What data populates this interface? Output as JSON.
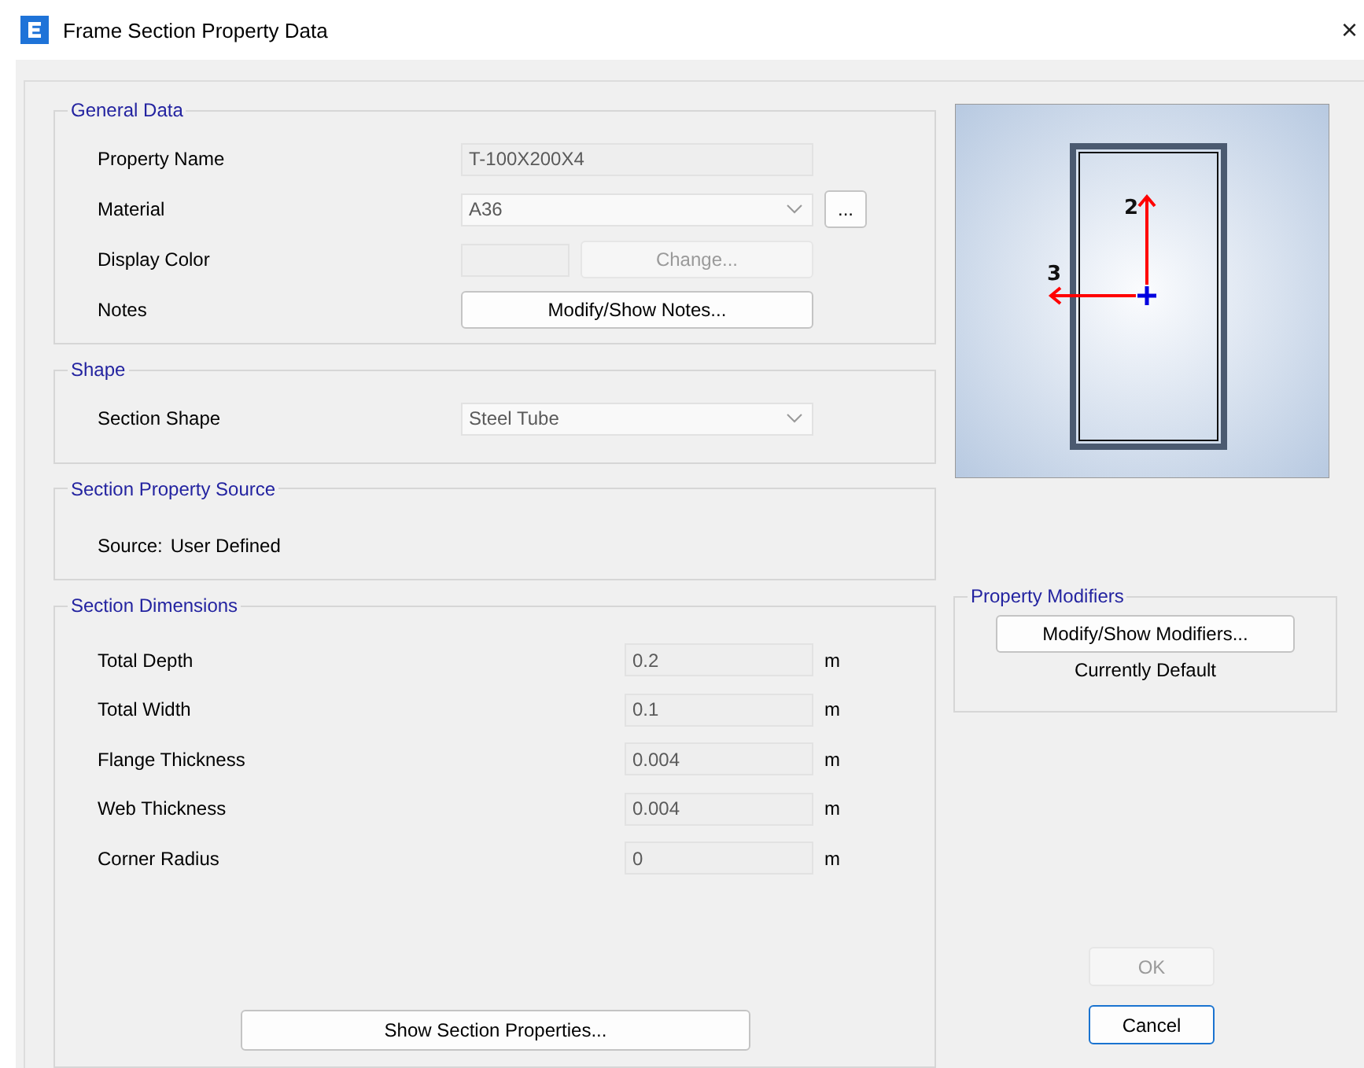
{
  "window": {
    "title": "Frame Section Property Data",
    "close": "×"
  },
  "general_data": {
    "title": "General Data",
    "rows": [
      {
        "kind": "text",
        "label": "Property Name",
        "value": "T-100X200X4",
        "disabled": true
      },
      {
        "kind": "dropdown",
        "label": "Material",
        "value": "A36",
        "disabled": true,
        "extra_button": "..."
      },
      {
        "kind": "color",
        "label": "Display Color",
        "button": "Change...",
        "disabled": true
      },
      {
        "kind": "button",
        "label": "Notes",
        "button": "Modify/Show Notes...",
        "disabled": false
      }
    ]
  },
  "shape": {
    "title": "Shape",
    "rows": [
      {
        "kind": "dropdown",
        "label": "Section Shape",
        "value": "Steel Tube",
        "disabled": true
      }
    ]
  },
  "source": {
    "title": "Section Property Source",
    "label": "Source:",
    "value": "User Defined"
  },
  "dimensions": {
    "title": "Section Dimensions",
    "rows": [
      {
        "label": "Total Depth",
        "value": "0.2",
        "unit": "m"
      },
      {
        "label": "Total Width",
        "value": "0.1",
        "unit": "m"
      },
      {
        "label": "Flange Thickness",
        "value": "0.004",
        "unit": "m"
      },
      {
        "label": "Web Thickness",
        "value": "0.004",
        "unit": "m"
      },
      {
        "label": "Corner Radius",
        "value": "0",
        "unit": "m"
      }
    ],
    "button": "Show Section Properties..."
  },
  "preview": {
    "axis_labels": [
      "2",
      "3"
    ]
  },
  "modifiers": {
    "title": "Property Modifiers",
    "button": "Modify/Show Modifiers...",
    "status": "Currently Default"
  },
  "buttons": [
    {
      "label": "OK",
      "disabled": true,
      "focused": false
    },
    {
      "label": "Cancel",
      "disabled": false,
      "focused": true
    }
  ]
}
